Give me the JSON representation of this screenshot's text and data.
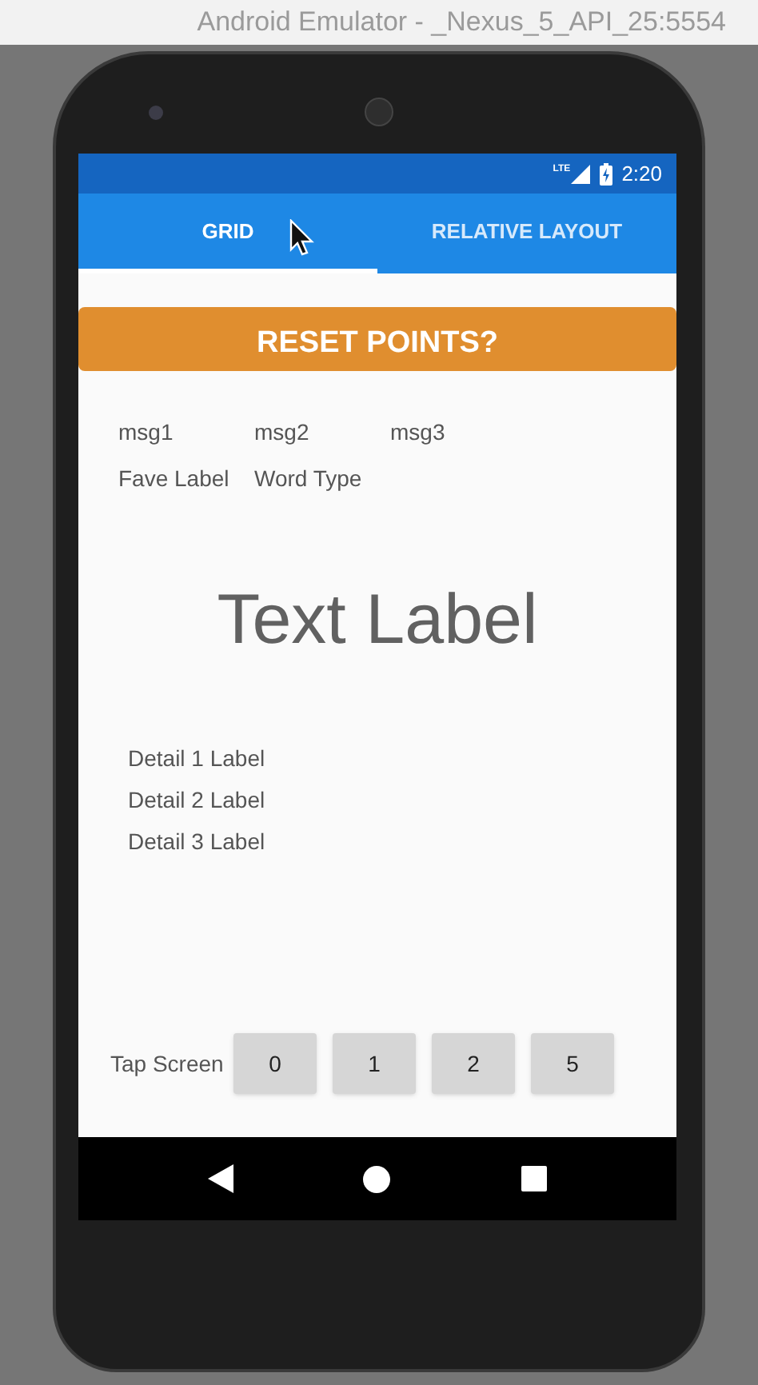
{
  "window": {
    "title": "Android Emulator - _Nexus_5_API_25:5554"
  },
  "status_bar": {
    "network": "LTE",
    "time": "2:20"
  },
  "tabs": [
    {
      "label": "GRID",
      "selected": true
    },
    {
      "label": "RELATIVE LAYOUT",
      "selected": false
    }
  ],
  "reset_button": {
    "label": "RESET POINTS?"
  },
  "messages": [
    "msg1",
    "msg2",
    "msg3"
  ],
  "labels": [
    "Fave Label",
    "Word Type"
  ],
  "main_label": "Text Label",
  "details": [
    "Detail 1 Label",
    "Detail 2 Label",
    "Detail 3 Label"
  ],
  "tap_label": "Tap Screen",
  "number_buttons": [
    "0",
    "1",
    "2",
    "5"
  ]
}
